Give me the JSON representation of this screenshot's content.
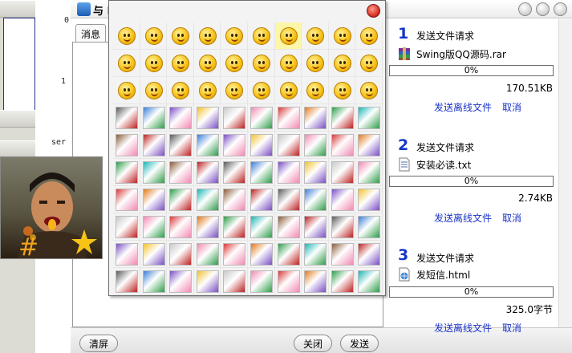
{
  "sidebar": {
    "strip_marks": [
      "0",
      "1",
      "ser"
    ],
    "toggles": [
      {
        "icon": "chevron-up-double-icon",
        "glyph": "˄"
      },
      {
        "icon": "chevron-down-double-icon",
        "glyph": "˅"
      },
      {
        "icon": "chevron-up-double-icon",
        "glyph": "˄"
      }
    ]
  },
  "chat": {
    "title": "与 I",
    "tab_label": "消息",
    "clear_button": "清屏",
    "close_button": "关闭",
    "send_button": "发送"
  },
  "transfers": [
    {
      "number": "1",
      "title": "发送文件请求",
      "file_icon": "winrar-archive-icon",
      "file_name": "Swing版QQ源码.rar",
      "progress": 0,
      "progress_text": "0%",
      "size": "170.51KB",
      "offline_link": "发送离线文件",
      "cancel_link": "取消"
    },
    {
      "number": "2",
      "title": "发送文件请求",
      "file_icon": "text-document-icon",
      "file_name": "安装必读.txt",
      "progress": 0,
      "progress_text": "0%",
      "size": "2.74KB",
      "offline_link": "发送离线文件",
      "cancel_link": "取消"
    },
    {
      "number": "3",
      "title": "发送文件请求",
      "file_icon": "html-document-icon",
      "file_name": "发短信.html",
      "progress": 0,
      "progress_text": "0%",
      "size": "325.0字节",
      "offline_link": "发送离线文件",
      "cancel_link": "取消"
    }
  ],
  "emoticon_picker": {
    "rows": 10,
    "cols": 10,
    "selected_index": 6,
    "face_row_count": 3,
    "palette": [
      "#d8383a",
      "#3a7fd6",
      "#2f9c4a",
      "#f2c12e",
      "#8a5a3a",
      "#f08ab2",
      "#5a5a5a",
      "#e07a1f",
      "#7a4fc2",
      "#1bb5b5",
      "#c9c9c9",
      "#b22"
    ]
  },
  "colors": {
    "accent_blue": "#1737c8",
    "link_blue": "#1a33c8",
    "progress_fill": "#3a74c9"
  }
}
